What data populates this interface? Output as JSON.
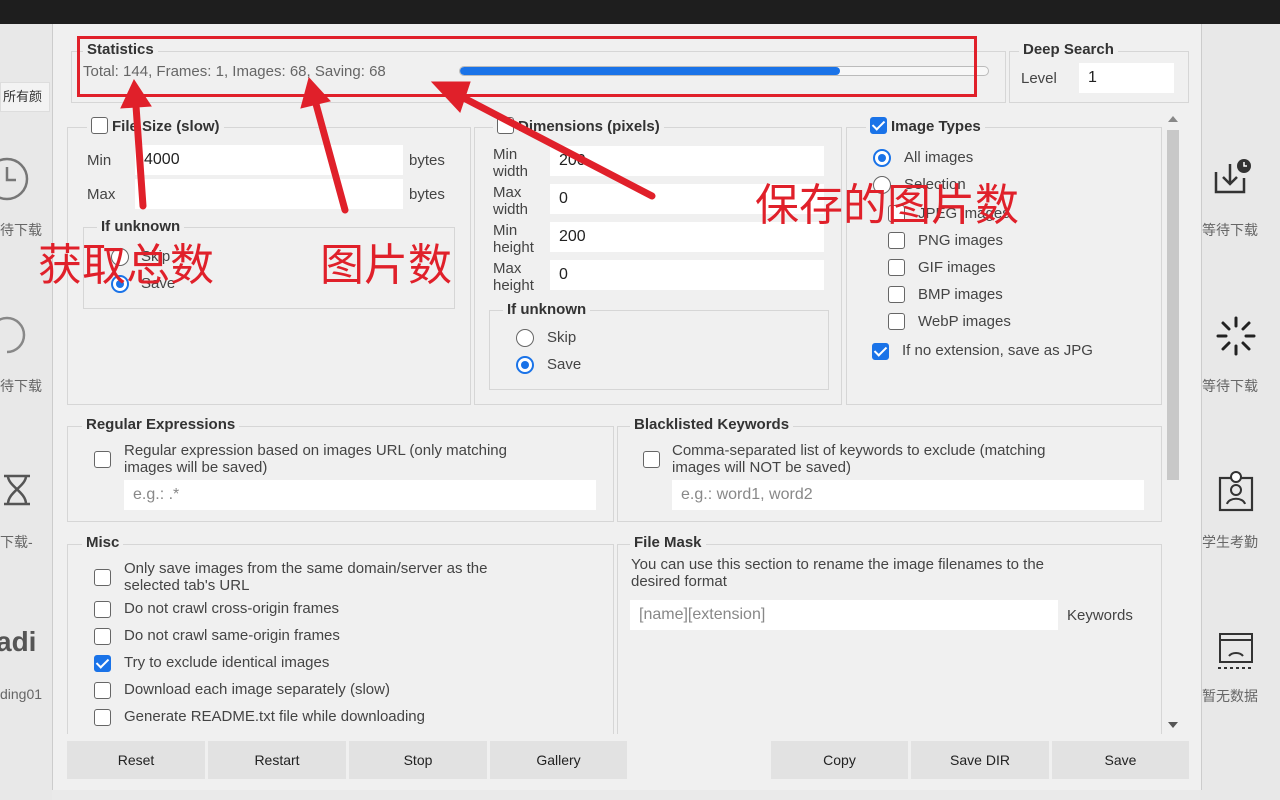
{
  "background": {
    "chip_label": "所有颜",
    "left_items": [
      "待下载",
      "待下载",
      "下载-",
      "adi",
      "ding01"
    ],
    "right_items": [
      "等待下载",
      "等待下载",
      "学生考勤",
      "暂无数据"
    ]
  },
  "statistics": {
    "title": "Statistics",
    "total_label": "Total:",
    "total": "144",
    "frames_label": "Frames:",
    "frames": "1",
    "images_label": "Images:",
    "images": "68",
    "saving_label": "Saving:",
    "saving": "68",
    "progress_fraction": 0.72
  },
  "deep_search": {
    "title": "Deep Search",
    "level_label": "Level",
    "level_value": "1"
  },
  "file_size": {
    "title": "File Size (slow)",
    "min_label": "Min",
    "min_value": "4000",
    "max_label": "Max",
    "max_value": "",
    "unit": "bytes",
    "if_unknown": "If unknown",
    "skip": "Skip",
    "save": "Save"
  },
  "dimensions": {
    "title": "Dimensions (pixels)",
    "min_width_label": [
      "Min",
      "width"
    ],
    "min_width": "200",
    "max_width_label": [
      "Max",
      "width"
    ],
    "max_width": "0",
    "min_height_label": [
      "Min",
      "height"
    ],
    "min_height": "200",
    "max_height_label": [
      "Max",
      "height"
    ],
    "max_height": "0",
    "if_unknown": "If unknown",
    "skip": "Skip",
    "save": "Save"
  },
  "image_types": {
    "title": "Image Types",
    "all_images": "All images",
    "selection": "Selection",
    "jpeg": "JPEG images",
    "png": "PNG images",
    "gif": "GIF images",
    "bmp": "BMP images",
    "webp": "WebP images",
    "no_ext": "If no extension, save as JPG"
  },
  "regex": {
    "title": "Regular Expressions",
    "desc_1": "Regular expression based on images URL (only matching",
    "desc_2": "images will be saved)",
    "placeholder": "e.g.: .*"
  },
  "blacklist": {
    "title": "Blacklisted Keywords",
    "desc_1": "Comma-separated list of keywords to exclude (matching",
    "desc_2": "images will NOT be saved)",
    "placeholder": "e.g.: word1, word2"
  },
  "misc": {
    "title": "Misc",
    "same_domain_1": "Only save images from the same domain/server as the",
    "same_domain_2": "selected tab's URL",
    "no_cross_origin": "Do not crawl cross-origin frames",
    "no_same_origin": "Do not crawl same-origin frames",
    "exclude_identical": "Try to exclude identical images",
    "separately": "Download each image separately (slow)",
    "readme": "Generate README.txt file while downloading"
  },
  "file_mask": {
    "title": "File Mask",
    "desc_1": "You can use this section to rename the image filenames to the",
    "desc_2": "desired format",
    "placeholder": "[name][extension]",
    "keywords": "Keywords"
  },
  "buttons": {
    "reset": "Reset",
    "restart": "Restart",
    "stop": "Stop",
    "gallery": "Gallery",
    "copy": "Copy",
    "save_dir": "Save DIR",
    "save": "Save"
  },
  "annotations": {
    "total": "获取总数",
    "images": "图片数",
    "saving": "保存的图片数"
  },
  "colors": {
    "accent": "#1a73e8",
    "annotation": "#e0202a"
  }
}
